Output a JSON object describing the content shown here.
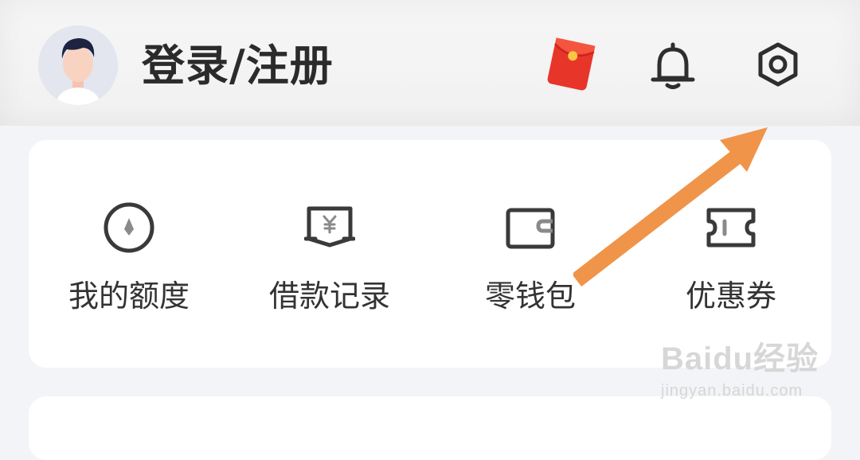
{
  "header": {
    "login_label": "登录/注册",
    "icons": [
      "avatar",
      "red-packet-icon",
      "bell-icon",
      "settings-icon"
    ]
  },
  "menu": {
    "items": [
      {
        "label": "我的额度",
        "icon": "credit-limit-icon"
      },
      {
        "label": "借款记录",
        "icon": "loan-record-icon"
      },
      {
        "label": "零钱包",
        "icon": "wallet-icon"
      },
      {
        "label": "优惠券",
        "icon": "coupon-icon"
      }
    ]
  },
  "colors": {
    "accent_arrow": "#f0944a",
    "red_packet": "#e8352a",
    "icon_stroke": "#3a3a3a"
  },
  "watermark": {
    "brand": "Baidu经验",
    "url": "jingyan.baidu.com"
  }
}
